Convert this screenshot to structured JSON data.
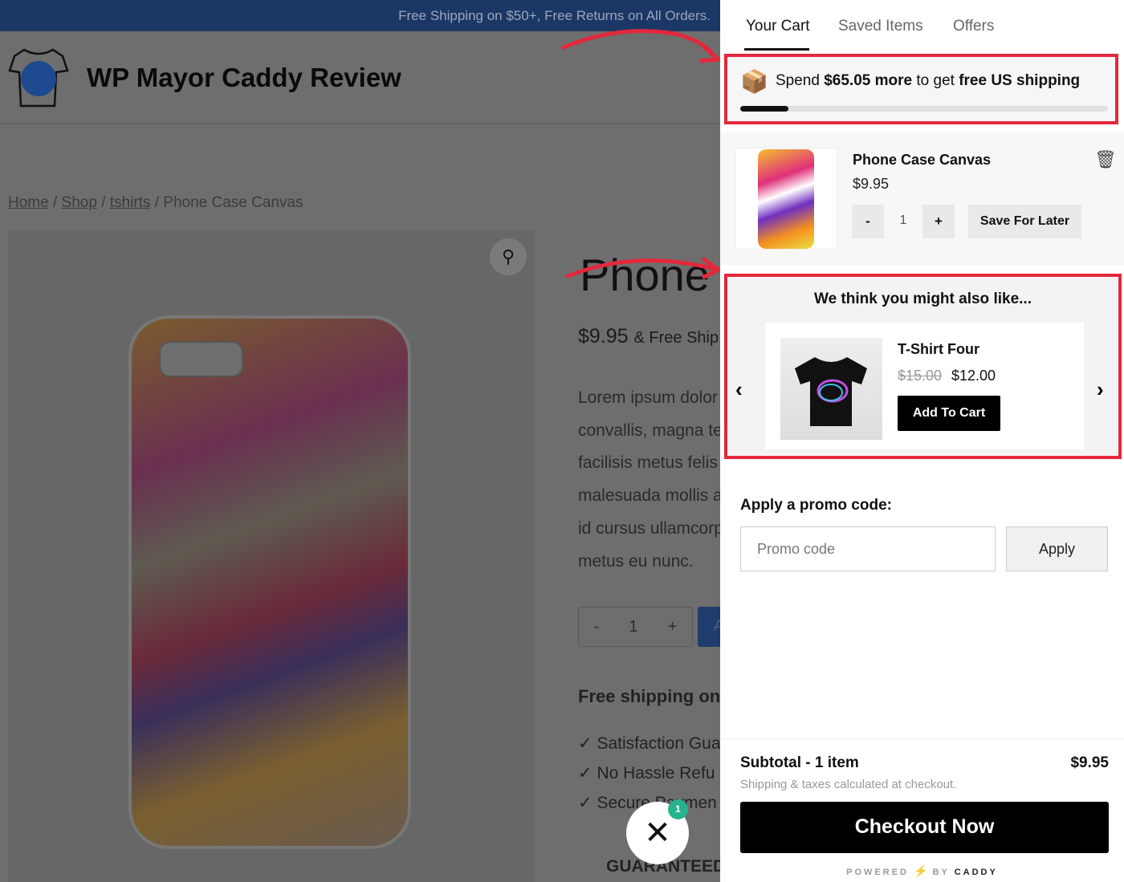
{
  "announcement": "Free Shipping on $50+, Free Returns on All Orders.",
  "site": {
    "title": "WP Mayor Caddy Review"
  },
  "breadcrumb": {
    "home": "Home",
    "shop": "Shop",
    "category": "tshirts",
    "current": "Phone Case Canvas",
    "separator": "/"
  },
  "product": {
    "title": "Phone",
    "price": "$9.95",
    "price_suffix": "& Free Ship",
    "description_lines": [
      "Lorem ipsum dolor",
      "convallis, magna te",
      "facilisis metus felis",
      "malesuada mollis a",
      "id cursus ullamcorp",
      "metus eu nunc."
    ],
    "qty_minus": "-",
    "qty": "1",
    "qty_plus": "+",
    "add_label": "A",
    "shipping_heading": "Free shipping on c",
    "features": [
      "Satisfaction Gua",
      "No Hassle Refu",
      "Secure Paymen"
    ],
    "guaranteed": "GUARANTEED"
  },
  "fab": {
    "badge": "1",
    "icon": "close-icon"
  },
  "cart": {
    "tabs": [
      "Your Cart",
      "Saved Items",
      "Offers"
    ],
    "active_tab": "Your Cart",
    "shipping_bar": {
      "prefix": "Spend ",
      "amount": "$65.05 more",
      "middle": " to get ",
      "goal": "free US shipping",
      "progress_percent": 13
    },
    "item": {
      "name": "Phone Case Canvas",
      "price": "$9.95",
      "qty_minus": "-",
      "qty": "1",
      "qty_plus": "+",
      "save_later": "Save For Later"
    },
    "recommendations": {
      "title": "We think you might also like...",
      "name": "T-Shirt Four",
      "old_price": "$15.00",
      "price": "$12.00",
      "add_label": "Add To Cart"
    },
    "promo": {
      "label": "Apply a promo code:",
      "placeholder": "Promo code",
      "value": "",
      "apply": "Apply"
    },
    "subtotal_label": "Subtotal - 1 item",
    "subtotal_value": "$9.95",
    "shipping_note": "Shipping & taxes calculated at checkout.",
    "checkout": "Checkout Now",
    "powered": {
      "left": "POWERED",
      "by": "BY",
      "brand": "CADDY"
    }
  },
  "colors": {
    "highlight": "#e3283b",
    "topbar": "#1b3766",
    "badge": "#27b38c",
    "checkout": "#000000"
  }
}
